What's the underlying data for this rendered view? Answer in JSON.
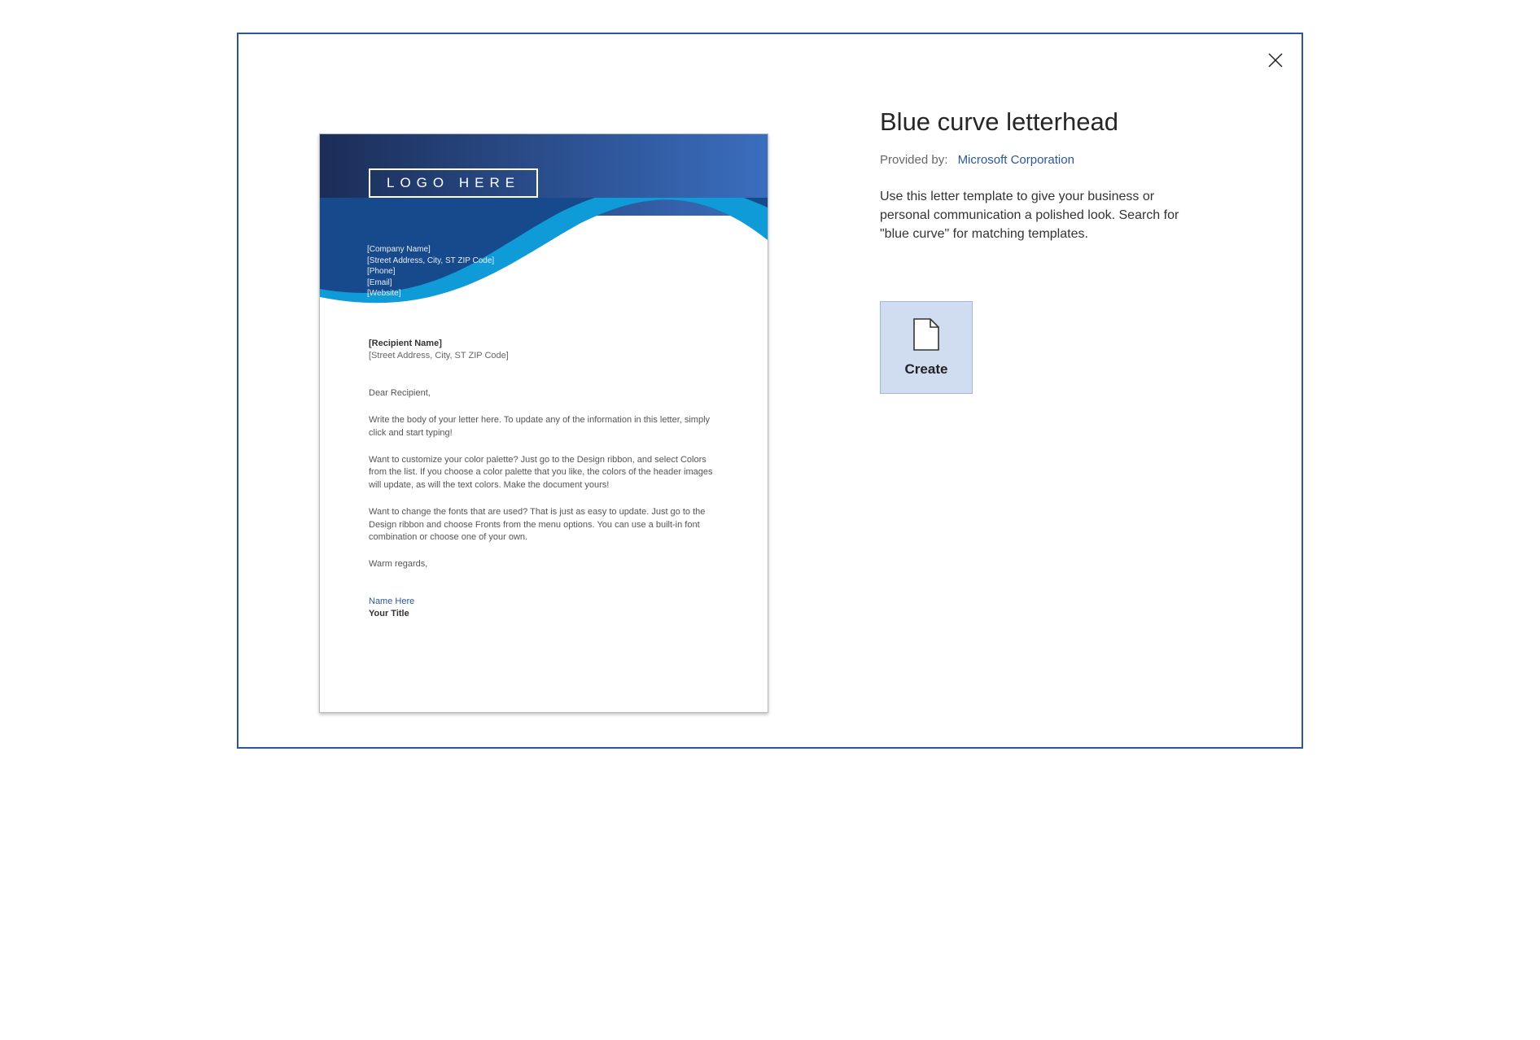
{
  "dialog": {
    "title": "Blue curve letterhead",
    "provided_label": "Provided by:",
    "provider": "Microsoft Corporation",
    "description": "Use this letter template to give your business or personal communication a polished look. Search for \"blue curve\" for matching templates.",
    "create_label": "Create"
  },
  "preview": {
    "logo": "LOGO HERE",
    "company": {
      "name": "[Company Name]",
      "addr": "[Street Address, City, ST ZIP Code]",
      "phone": "[Phone]",
      "email": "[Email]",
      "website": "[Website]"
    },
    "recipient_name": "[Recipient Name]",
    "recipient_addr": "[Street Address, City, ST ZIP Code]",
    "greeting": "Dear Recipient,",
    "p1": "Write the body of your letter here.  To update any of the information in this letter, simply click and start typing!",
    "p2": "Want to customize your color palette?  Just go to the Design ribbon, and select Colors from the list.  If you choose a color palette that you like, the colors of the header images will update, as will the text colors.  Make the document yours!",
    "p3": "Want to change the fonts that are used?  That is just as easy to update.  Just go to the Design ribbon and choose Fronts from the menu options.  You can use a built-in font combination or choose one of your own.",
    "closing": "Warm regards,",
    "sig_name": "Name Here",
    "sig_title": "Your Title"
  }
}
